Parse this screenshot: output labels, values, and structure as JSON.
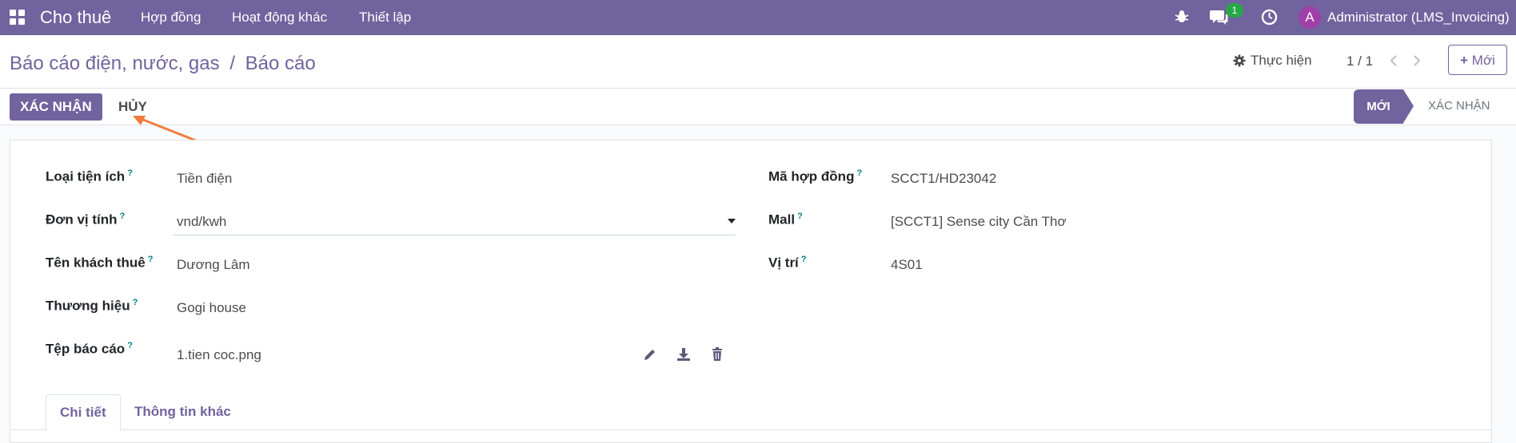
{
  "navbar": {
    "app_title": "Cho thuê",
    "menu": [
      "Hợp đồng",
      "Hoạt động khác",
      "Thiết lập"
    ],
    "chat_badge": "1",
    "avatar_letter": "A",
    "user": "Administrator (LMS_Invoicing)"
  },
  "control": {
    "breadcrumb_parent": "Báo cáo điện, nước, gas",
    "breadcrumb_sep": "/",
    "breadcrumb_current": "Báo cáo",
    "action_label": "Thực hiện",
    "pager": "1 / 1",
    "new_label": "Mới"
  },
  "status": {
    "confirm_label": "XÁC NHẬN",
    "cancel_label": "HỦY",
    "stages": [
      "MỚI",
      "XÁC NHẬN"
    ],
    "active_stage": "MỚI"
  },
  "form": {
    "left": [
      {
        "label": "Loại tiện ích",
        "value": "Tiền điện"
      },
      {
        "label": "Đơn vị tính",
        "value": "vnd/kwh"
      },
      {
        "label": "Tên khách thuê",
        "value": "Dương Lâm"
      },
      {
        "label": "Thương hiệu",
        "value": "Gogi house"
      },
      {
        "label": "Tệp báo cáo",
        "value": "1.tien coc.png"
      }
    ],
    "right": [
      {
        "label": "Mã hợp đồng",
        "value": "SCCT1/HD23042"
      },
      {
        "label": "Mall",
        "value": "[SCCT1] Sense city Cần Thơ"
      },
      {
        "label": "Vị trí",
        "value": "4S01"
      }
    ],
    "help_mark": "?"
  },
  "tabs": [
    "Chi tiết",
    "Thông tin khác"
  ],
  "colors": {
    "brand": "#71639e",
    "badge": "#28a745",
    "avatar": "#a03fa7",
    "arrow": "#f07c3c"
  }
}
